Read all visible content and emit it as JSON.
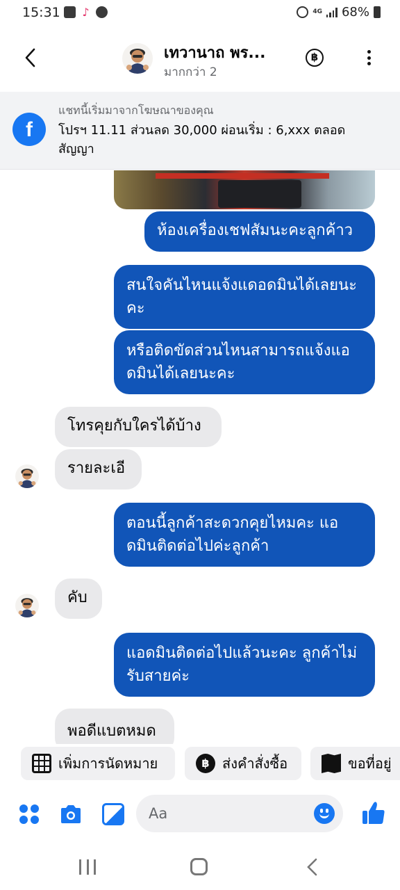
{
  "status_bar": {
    "time": "15:31",
    "battery": "68%",
    "network": "4G"
  },
  "header": {
    "contact_name": "เทวานาถ พร...",
    "subtitle": "มากกว่า 2",
    "pay_icon": "baht-icon",
    "more_icon": "more-icon"
  },
  "ad_banner": {
    "caption": "แชทนี้เริ่มมาจากโฆษณาของคุณ",
    "text": "โปรฯ 11.11 ส่วนลด 30,000 ผ่อนเริ่ม : 6,xxx ตลอดสัญญา"
  },
  "messages": [
    {
      "side": "out",
      "text": "ห้องเครื่องเชฟสัมนะคะลูกค้าว"
    },
    {
      "side": "out",
      "text": "สนใจคันไหนแจ้งแดอดมินได้เลยนะคะ"
    },
    {
      "side": "out",
      "text": "หรือติดขัดส่วนไหนสามารถแจ้งแอดมินได้เลยนะคะ"
    },
    {
      "side": "in",
      "text": "โทรคุยกับใครได้บ้าง"
    },
    {
      "side": "in",
      "text": "รายละเอี"
    },
    {
      "side": "out",
      "text": "ตอนนี้ลูกค้าสะดวกคุยไหมคะ แอดมินติดต่อไปค่ะลูกค้า"
    },
    {
      "side": "in",
      "text": "คับ"
    },
    {
      "side": "out",
      "text": "แอดมินติดต่อไปแล้วนะคะ ลูกค้าไม่รับสายค่ะ"
    },
    {
      "side": "in",
      "text": "พอดีแบตหมด"
    }
  ],
  "quick_replies": [
    {
      "label": "เพิ่มการนัดหมาย",
      "icon": "calendar-icon"
    },
    {
      "label": "ส่งคำสั่งซื้อ",
      "icon": "baht-icon"
    },
    {
      "label": "ขอที่อยู่",
      "icon": "map-icon"
    }
  ],
  "composer": {
    "placeholder": "Aa"
  },
  "colors": {
    "outgoing_bubble": "#1155b8",
    "incoming_bubble": "#e9e9eb",
    "accent": "#1877f2"
  }
}
